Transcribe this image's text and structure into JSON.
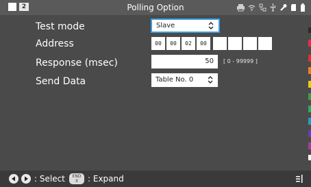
{
  "header": {
    "page_number": "2",
    "title": "Polling Option",
    "status_icons": [
      "printer-icon",
      "wifi-icon",
      "network-icon",
      "usb-icon",
      "tool-icon",
      "sd-card-icon",
      "battery-icon"
    ]
  },
  "rows": {
    "test_mode": {
      "label": "Test mode",
      "value": "Slave"
    },
    "address": {
      "label": "Address",
      "octets": [
        "00",
        "00",
        "02",
        "00",
        "",
        "",
        "",
        ""
      ]
    },
    "response": {
      "label": "Response (msec)",
      "value": "50",
      "range": "[ 0 - 99999 ]"
    },
    "send_data": {
      "label": "Send Data",
      "value": "Table No. 0"
    }
  },
  "footer": {
    "select_label": ": Select",
    "end_key_top": "END",
    "end_key_bottom": "X",
    "expand_label": ": Expand"
  },
  "colors": {
    "accent": "#3aa0e0",
    "side_strip": [
      "#2a2a2a",
      "#e0304a",
      "#e03030",
      "#f08020",
      "#e8d000",
      "#3aa040",
      "#20b060",
      "#20a0c0",
      "#6040c0",
      "#a040a0",
      "#9a9a9a",
      "#ffffff"
    ]
  }
}
